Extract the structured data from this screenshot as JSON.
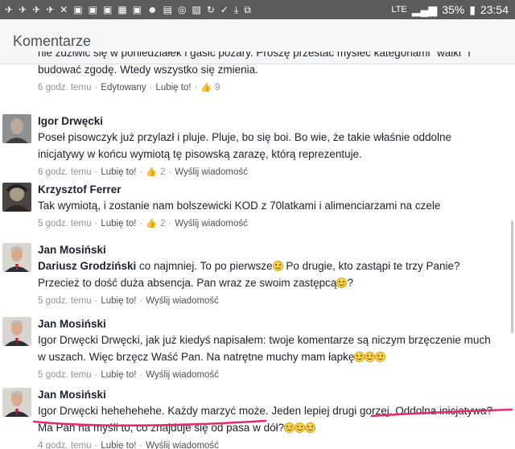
{
  "status": {
    "network": "LTE",
    "battery": "35%",
    "time": "23:54"
  },
  "header": {
    "title": "Komentarze"
  },
  "first_comment": {
    "line_cut": "nie zdziwić się w poniedziałek i gasić pożary. Proszę przestać myśleć kategoriami \"walki\" i zacząć",
    "line2": "budować zgodę. Wtedy wszystko się zmienia.",
    "time": "6 godz. temu",
    "edited": "Edytowany",
    "like": "Lubię to!",
    "likes": "9"
  },
  "comments": [
    {
      "author": "Igor Drwęcki",
      "text": "Poseł pisowczyk już przylazł i pluje. Pluje, bo się boi. Bo wie, że takie właśnie oddolne inicjatywy w końcu wymiotą tę pisowską zarazę, którą reprezentuje.",
      "time": "6 godz. temu",
      "like": "Lubię to!",
      "likes": "2",
      "message": "Wyślij wiadomość"
    },
    {
      "author": "Krzysztof Ferrer",
      "text": "Tak wymiotą, i zostanie nam bolszewicki KOD z 70latkami i alimenciarzami na czele",
      "time": "5 godz. temu",
      "like": "Lubię to!",
      "likes": "2",
      "message": "Wyślij wiadomość"
    },
    {
      "author": "Jan Mosiński",
      "mention": "Dariusz Grodziński",
      "text_a": " co najmniej. To po pierwsze",
      "text_b": " Po drugie, kto zastąpi te trzy Panie? Przecież to dość duża absencja. Pan wraz ze swoim zastępcą",
      "text_c": "?",
      "time": "5 godz. temu",
      "like": "Lubię to!",
      "message": "Wyślij wiadomość"
    },
    {
      "author": "Jan Mosiński",
      "text": "Igor Drwęcki Drwęcki, jak już kiedyś napisałem: twoje komentarze są niczym brzęczenie much w uszach. Więc brzęcz Waść Pan. Na natrętne muchy mam łapkę",
      "time": "5 godz. temu",
      "like": "Lubię to!",
      "message": "Wyślij wiadomość"
    },
    {
      "author": "Jan Mosiński",
      "text": "Igor Drwęcki hehehehehe. Każdy marzyć może. Jeden lepiej drugi gorzej. Oddolna inicjatywa? Ma Pan na myśli to, co znajduje się od pasa w dół?",
      "time": "4 godz. temu",
      "like": "Lubię to!",
      "message": "Wyślij wiadomość"
    }
  ],
  "colors": {
    "accent_underline": "#e8286b",
    "statusbar": "#5b5b5b",
    "appbar": "#f5f6f7",
    "meta_text": "#90949c"
  }
}
